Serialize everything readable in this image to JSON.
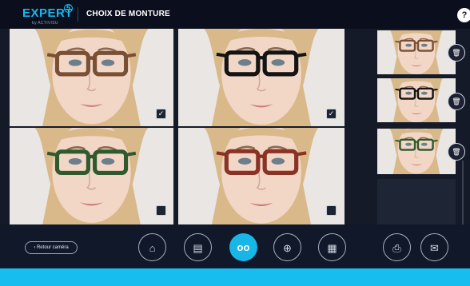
{
  "header": {
    "logo_text": "EXPERT",
    "logo_superscript": "5",
    "logo_subtext": "by ACTIVISU",
    "title": "CHOIX DE MONTURE",
    "help_label": "?"
  },
  "main_grid": [
    {
      "frame": "tortoise",
      "frame_color": "#7a5034",
      "checked": true,
      "check_glyph": "✓"
    },
    {
      "frame": "black",
      "frame_color": "#141414",
      "checked": true,
      "check_glyph": "✓"
    },
    {
      "frame": "green",
      "frame_color": "#2f5a2d",
      "checked": false,
      "check_glyph": ""
    },
    {
      "frame": "red",
      "frame_color": "#8a3224",
      "checked": false,
      "check_glyph": ""
    }
  ],
  "sidebar_thumbnails": [
    {
      "frame": "tortoise",
      "frame_color": "#7a5034",
      "delete_icon": "trash-icon"
    },
    {
      "frame": "black",
      "frame_color": "#141414",
      "delete_icon": "trash-icon"
    },
    {
      "frame": "green",
      "frame_color": "#2f5a2d",
      "delete_icon": "trash-icon"
    }
  ],
  "toolbar": {
    "back_label": "‹ Retour caméra",
    "tools": [
      {
        "name": "home",
        "icon": "home-icon",
        "glyph": "⌂"
      },
      {
        "name": "document",
        "icon": "document-icon",
        "glyph": "▤"
      },
      {
        "name": "glasses",
        "icon": "glasses-icon",
        "glyph": "oo",
        "active": true
      },
      {
        "name": "compare",
        "icon": "compare-icon",
        "glyph": "⊕"
      },
      {
        "name": "gallery",
        "icon": "gallery-icon",
        "glyph": "▦"
      },
      {
        "name": "print",
        "icon": "print-icon",
        "glyph": "⎙"
      },
      {
        "name": "email",
        "icon": "email-icon",
        "glyph": "✉"
      }
    ]
  },
  "colors": {
    "accent": "#18bdf0",
    "header_bg": "#0b0f1d",
    "toolbar_bg": "#10182a"
  }
}
